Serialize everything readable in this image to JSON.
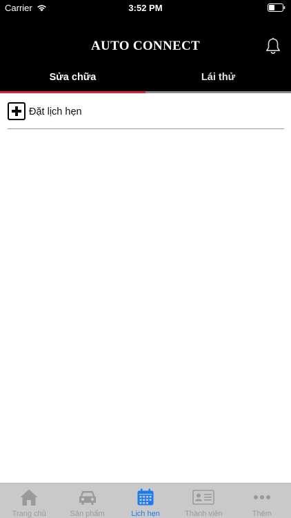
{
  "status_bar": {
    "carrier": "Carrier",
    "time": "3:52 PM"
  },
  "header": {
    "title": "AUTO CONNECT",
    "notification_icon": "bell-icon"
  },
  "tabs": [
    {
      "label": "Sửa chữa",
      "active": true
    },
    {
      "label": "Lái thử",
      "active": false
    }
  ],
  "book_appointment": {
    "label": "Đặt lịch hẹn",
    "icon": "plus-square-icon"
  },
  "bottom_nav": [
    {
      "label": "Trang chủ",
      "icon": "home-icon",
      "active": false
    },
    {
      "label": "Sản phẩm",
      "icon": "car-icon",
      "active": false
    },
    {
      "label": "Lịch hẹn",
      "icon": "calendar-icon",
      "active": true
    },
    {
      "label": "Thành viên",
      "icon": "member-card-icon",
      "active": false
    },
    {
      "label": "Thêm",
      "icon": "more-icon",
      "active": false
    }
  ],
  "colors": {
    "header_bg": "#000000",
    "active_tab_underline": "#d9232e",
    "bottom_nav_active": "#1a7cf2",
    "bottom_nav_inactive": "#9a9a9a"
  }
}
